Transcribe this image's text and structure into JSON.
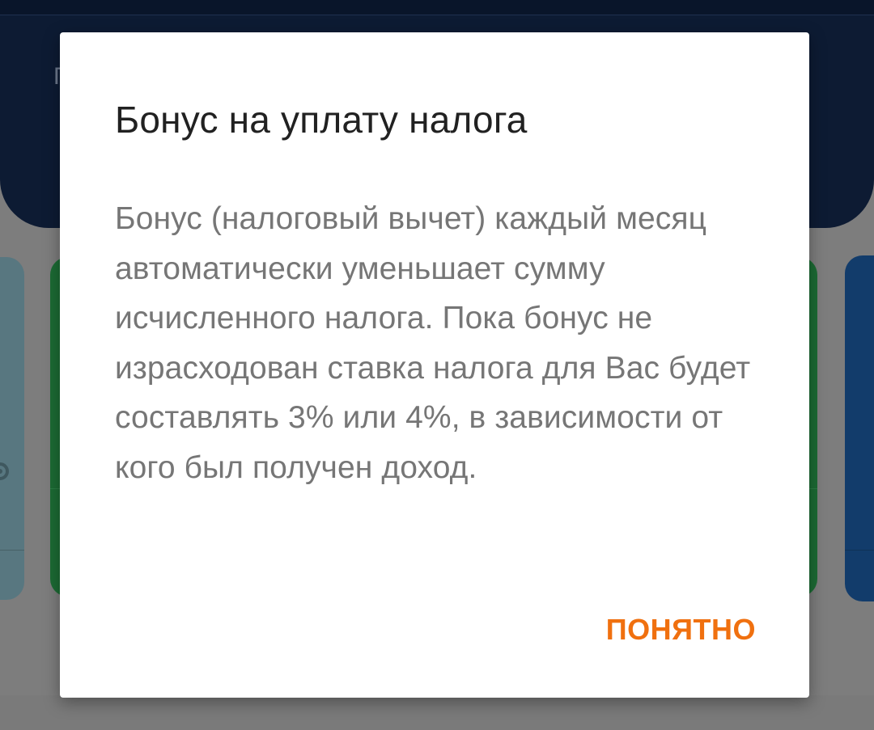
{
  "background": {
    "header_partial_text": "Г",
    "settings_icon": "gear-icon"
  },
  "dialog": {
    "title": "Бонус на уплату налога",
    "body": "Бонус (налоговый вычет) каждый месяц автоматически уменьшает сумму исчисленного налога. Пока бонус не израсходован ставка налога для Вас будет составлять 3% или 4%, в зависимости от кого был получен доход.",
    "ok_button_label": "ПОНЯТНО"
  },
  "colors": {
    "accent": "#f0700f",
    "header_bg": "#0d1b33",
    "green_card": "#1c6b34",
    "blue_card": "#123c6b"
  }
}
